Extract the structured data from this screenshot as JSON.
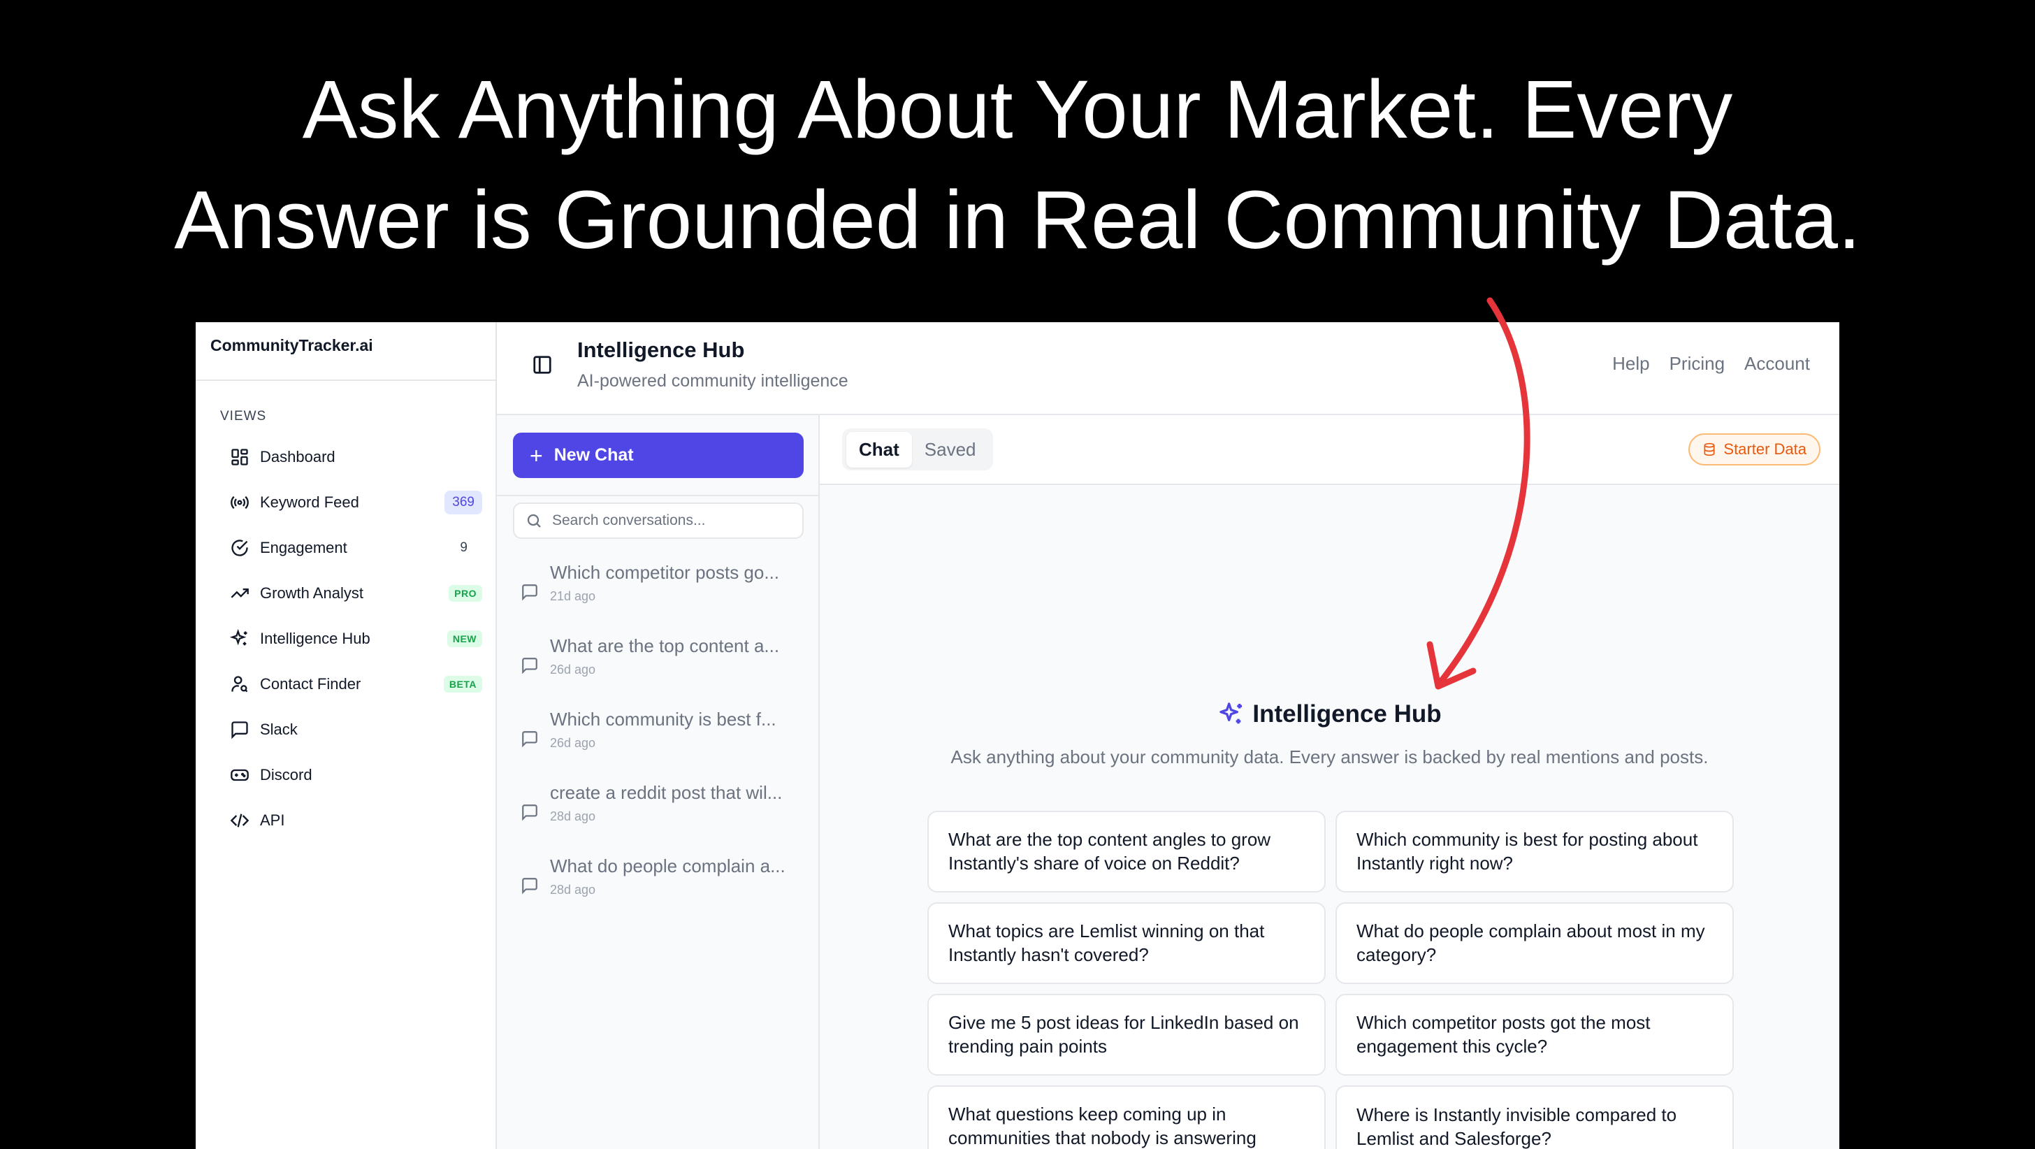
{
  "headline": {
    "line1": "Ask Anything About Your Market. Every",
    "line2": "Answer is Grounded in Real Community Data."
  },
  "sidebar": {
    "brand": "CommunityTracker.ai",
    "section_label": "VIEWS",
    "items": [
      {
        "label": "Dashboard",
        "icon": "dashboard-icon",
        "badge": ""
      },
      {
        "label": "Keyword Feed",
        "icon": "broadcast-icon",
        "badge": "369"
      },
      {
        "label": "Engagement",
        "icon": "check-circle-icon",
        "badge": "9"
      },
      {
        "label": "Growth Analyst",
        "icon": "trending-up-icon",
        "badge": "PRO"
      },
      {
        "label": "Intelligence Hub",
        "icon": "sparkles-icon",
        "badge": "NEW"
      },
      {
        "label": "Contact Finder",
        "icon": "user-search-icon",
        "badge": "BETA"
      },
      {
        "label": "Slack",
        "icon": "message-square-icon",
        "badge": ""
      },
      {
        "label": "Discord",
        "icon": "gamepad-icon",
        "badge": ""
      },
      {
        "label": "API",
        "icon": "code-icon",
        "badge": ""
      }
    ]
  },
  "topbar": {
    "title": "Intelligence Hub",
    "subtitle": "AI-powered community intelligence",
    "links": [
      "Help",
      "Pricing",
      "Account"
    ]
  },
  "chatlist": {
    "new_chat_label": "New Chat",
    "search_placeholder": "Search conversations...",
    "conversations": [
      {
        "title": "Which competitor posts go...",
        "time": "21d ago"
      },
      {
        "title": "What are the top content a...",
        "time": "26d ago"
      },
      {
        "title": "Which community is best f...",
        "time": "26d ago"
      },
      {
        "title": "create a reddit post that wil...",
        "time": "28d ago"
      },
      {
        "title": "What do people complain a...",
        "time": "28d ago"
      }
    ]
  },
  "main": {
    "tabs": [
      "Chat",
      "Saved"
    ],
    "active_tab": "Chat",
    "starter_label": "Starter Data",
    "hub_title": "Intelligence Hub",
    "hub_desc": "Ask anything about your community data. Every answer is backed by real mentions and posts.",
    "suggestions": [
      "What are the top content angles to grow Instantly's share of voice on Reddit?",
      "Which community is best for posting about Instantly right now?",
      "What topics are Lemlist winning on that Instantly hasn't covered?",
      "What do people complain about most in my category?",
      "Give me 5 post ideas for LinkedIn based on trending pain points",
      "Which competitor posts got the most engagement this cycle?",
      "What questions keep coming up in communities that nobody is answering",
      "Where is Instantly invisible compared to Lemlist and Salesforge?"
    ]
  },
  "colors": {
    "accent": "#4f46e5",
    "annotation_arrow": "#e5343a",
    "starter_badge": "#ea580c",
    "pro_badge": "#16a34a"
  }
}
